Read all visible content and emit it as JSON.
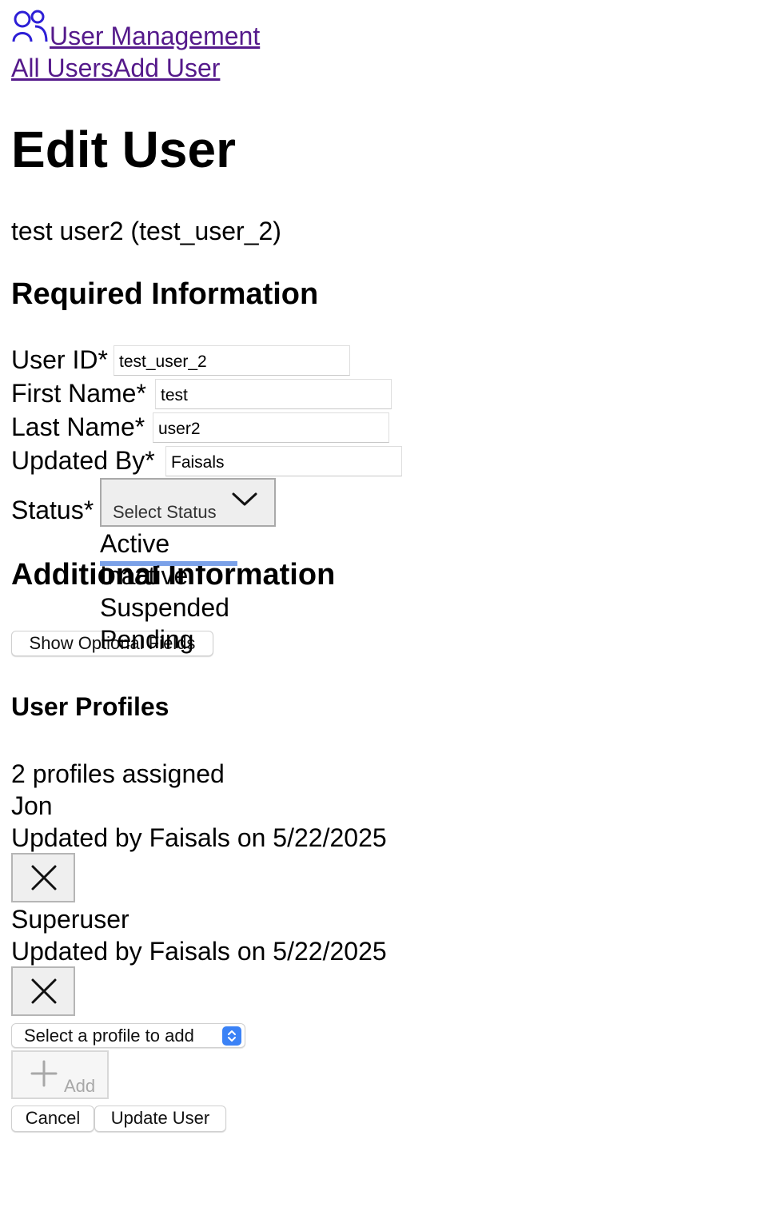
{
  "nav": {
    "app_title": "User Management",
    "links": [
      "All Users",
      "Add User"
    ]
  },
  "page": {
    "title": "Edit User",
    "subtitle": "test user2 (test_user_2)"
  },
  "required": {
    "heading": "Required Information",
    "fields": [
      {
        "label": "User ID*",
        "value": "test_user_2"
      },
      {
        "label": "First Name*",
        "value": "test"
      },
      {
        "label": "Last Name*",
        "value": "user2"
      },
      {
        "label": "Updated By*",
        "value": "Faisals"
      }
    ],
    "status": {
      "label": "Status*",
      "selected": "Select Status",
      "options": [
        "Active",
        "Inactive",
        "Suspended",
        "Pending"
      ]
    }
  },
  "additional": {
    "heading": "Additional Information",
    "toggle_label": "Show Optional Fields"
  },
  "profiles": {
    "heading": "User Profiles",
    "count_text": "2 profiles assigned",
    "items": [
      {
        "name": "Jon",
        "meta": "Updated by Faisals on 5/22/2025"
      },
      {
        "name": "Superuser",
        "meta": "Updated by Faisals on 5/22/2025"
      }
    ],
    "select_placeholder": "Select a profile to add",
    "add_label": "Add"
  },
  "actions": {
    "cancel_label": "Cancel",
    "submit_label": "Update User"
  },
  "colors": {
    "link": "#551a8b",
    "icon": "#2d1fd6",
    "option_highlight": "#7ba1e8",
    "select_spinner": "#3b82f6"
  },
  "icons": {
    "header": "users-icon",
    "status_dropdown": "chevron-down-icon",
    "remove": "close-icon",
    "add": "plus-icon",
    "profile_select": "select-arrows-icon"
  }
}
